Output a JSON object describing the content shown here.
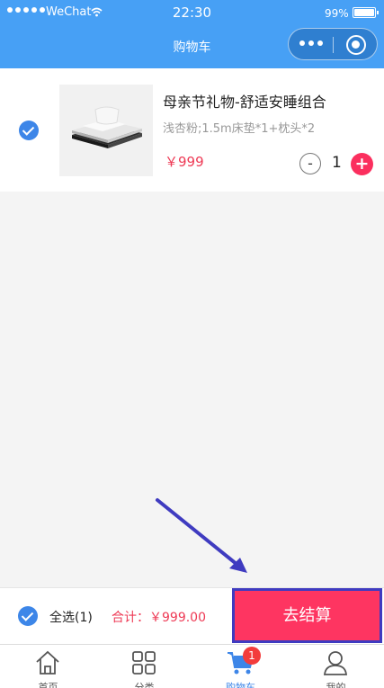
{
  "status_bar": {
    "carrier": "WeChat",
    "time": "22:30",
    "battery": "99%"
  },
  "nav": {
    "title": "购物车"
  },
  "cart": {
    "items": [
      {
        "title": "母亲节礼物-舒适安睡组合",
        "spec": "浅杏粉;1.5m床垫*1+枕头*2",
        "price": "￥999",
        "quantity": "1",
        "checked": true
      }
    ]
  },
  "checkout": {
    "select_all_label": "全选(1)",
    "total_label": "合计：",
    "total_value": "￥999.00",
    "button_label": "去结算"
  },
  "tabbar": {
    "tabs": [
      {
        "label": "首页",
        "icon": "home-icon"
      },
      {
        "label": "分类",
        "icon": "category-icon"
      },
      {
        "label": "购物车",
        "icon": "cart-icon"
      },
      {
        "label": "我的",
        "icon": "user-icon"
      }
    ],
    "cart_badge": "1"
  },
  "colors": {
    "header": "#47a0f5",
    "accent": "#3d86e8",
    "price": "#ee3a55",
    "checkout_button": "#fe3561",
    "annotation": "#3f3bc0"
  }
}
